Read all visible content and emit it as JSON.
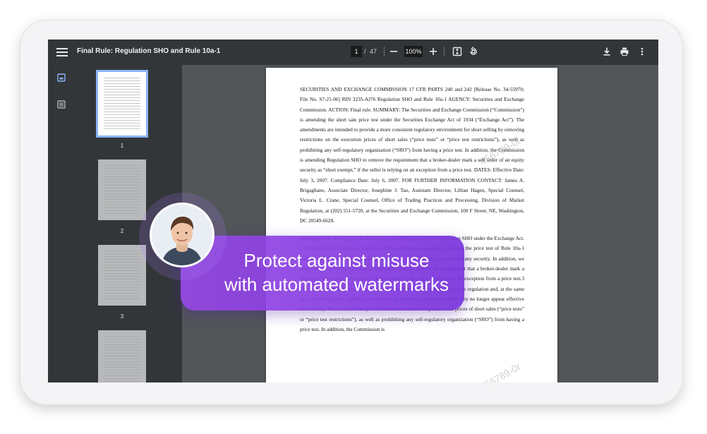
{
  "toolbar": {
    "title": "Final Rule: Regulation SHO and Rule 10a-1",
    "current_page": "1",
    "page_separator": "/",
    "total_pages": "47",
    "zoom": "100%"
  },
  "thumbnails": [
    {
      "label": "1",
      "active": true
    },
    {
      "label": "2",
      "active": false
    },
    {
      "label": "3",
      "active": false
    },
    {
      "label": "",
      "active": false
    }
  ],
  "document": {
    "paragraph_1": "SECURITIES AND EXCHANGE COMMISSION 17 CFR PARTS 240 and 242 [Release No. 34-55970; File No. S7-21-06] RIN 3235-AJ76 Regulation SHO and Rule 10a-1 AGENCY: Securities and Exchange Commission. ACTION: Final rule. SUMMARY: The Securities and Exchange Commission (“Commission”) is amending the short sale price test under the Securities Exchange Act of 1934 (“Exchange Act”). The amendments are intended to provide a more consistent regulatory environment for short selling by removing restrictions on the execution prices of short sales (“price tests” or “price test restrictions”), as well as prohibiting any self-regulatory organization (“SRO”) from having a price test. In addition, the Commission is amending Regulation SHO to remove the requirement that a broker-dealer mark a sell order of an equity security as “short exempt,” if the seller is relying on an exception from a price test. DATES: Effective Date: July 3, 2007. Compliance Date: July 6, 2007. FOR FURTHER INFORMATION CONTACT: James A. Brigagliano, Associate Director, Josephine J. Tao, Assistant Director, Lillian Hagen, Special Counsel, Victoria L. Crane, Special Counsel, Office of Trading Practices and Processing, Division of Market Regulation, at (202) 551-5720, at the Securities and Exchange Commission, 100 F Street, NE, Washington, DC 20549-6628.",
    "paragraph_2": "amending Rule 10a-1 [17 CFR 240.10a-1] and adding Rule 201 of Regulation SHO under the Exchange Act. I. Introduction A. Executive Summary. The Commission proposed to remove the price test of Rule 10a-1 and to prohibit any SRO from having a price test, including any price test for any security. In addition, we proposed to amend Rule 200(g) of Regulation SHO to remove the requirement that a broker-dealer mark a sell order of an equity security as “short exempt” if the seller is relying on an exception from a price test.3 The proposed amendments were designed to modernize and simplify short sale regulation and, at the same time, provide greater regulatory consistency by removing restrictions where they no longer appear effective or necessary. We received twenty-seven comment letters in response to the prices of short sales (“price tests” or “price test restrictions”), as well as prohibiting any self-regulatory organization (“SRO”) from having a price test. In addition, the Commission is"
  },
  "watermarks": [
    "456789-0r",
    "456789-0r"
  ],
  "banner": {
    "line1": "Protect against misuse",
    "line2": "with automated watermarks"
  },
  "colors": {
    "banner": "#8a44e4",
    "toolbar": "#323639",
    "canvas": "#525659",
    "active_thumb": "#8ab4f8"
  }
}
